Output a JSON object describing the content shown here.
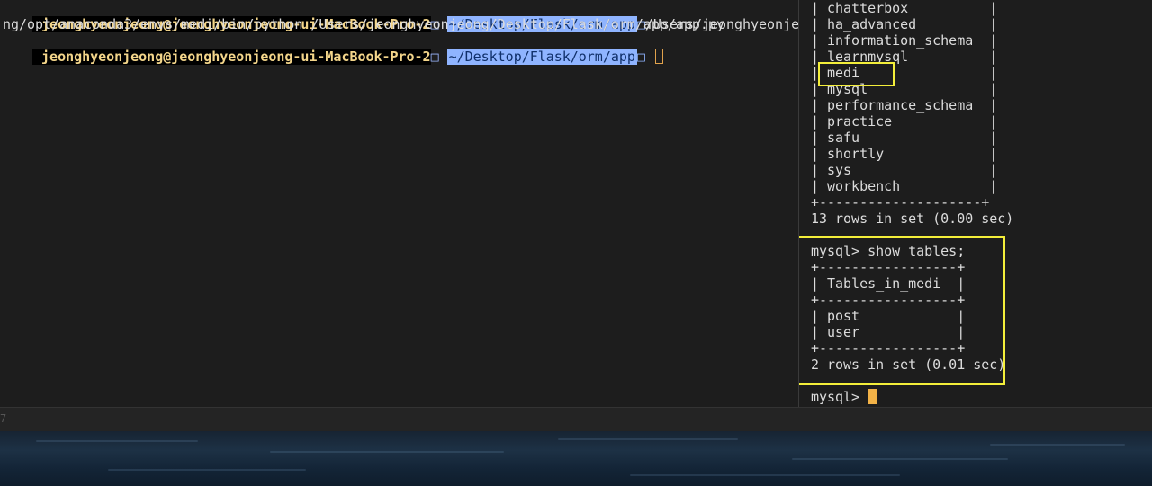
{
  "left_terminal": {
    "line1": {
      "user_host": "jeonghyeonjeong@jeonghyeonjeong-ui-MacBook-Pro-2",
      "sep": "□",
      "dir": "~/Desktop/Flask/orm/app",
      "arrow": "□",
      "cmd": "/Users/jeonghyeonjeo"
    },
    "line2": "ng/opt/anaconda3/envs/medi/bin/python /Users/jeonghyeonjeong/Desktop/Flask/orm/app/app.py",
    "line3": {
      "user_host": "jeonghyeonjeong@jeonghyeonjeong-ui-MacBook-Pro-2",
      "sep": "□",
      "dir": "~/Desktop/Flask/orm/app",
      "arrow": "□"
    }
  },
  "right_terminal": {
    "databases": [
      "| chatterbox          |",
      "| ha_advanced         |",
      "| information_schema  |",
      "| learnmysql          |",
      "| medi                |",
      "| mysql               |",
      "| performance_schema  |",
      "| practice            |",
      "| safu                |",
      "| shortly             |",
      "| sys                 |",
      "| workbench           |"
    ],
    "db_border": "+--------------------+",
    "db_summary": "13 rows in set (0.00 sec)",
    "command": "mysql> show tables;",
    "tables_border": "+-----------------+",
    "tables_header": "| Tables_in_medi  |",
    "tables": [
      "| post            |",
      "| user            |"
    ],
    "tables_summary": "2 rows in set (0.01 sec)",
    "prompt": "mysql> "
  },
  "status_bar": {
    "glyph": "7"
  }
}
